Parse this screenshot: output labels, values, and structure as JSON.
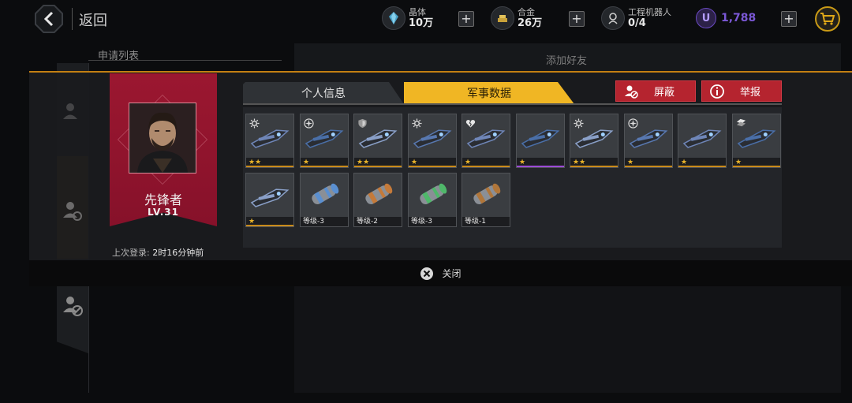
{
  "topbar": {
    "back_label": "返回",
    "crystal": {
      "name": "晶体",
      "value": "10万"
    },
    "alloy": {
      "name": "合金",
      "value": "26万"
    },
    "robots": {
      "name": "工程机器人",
      "value": "0/4"
    },
    "u_currency": {
      "symbol": "U",
      "value": "1,788"
    },
    "plus": "+"
  },
  "background": {
    "apply_list_label": "申请列表",
    "add_friend_label": "添加好友"
  },
  "profile": {
    "name": "先锋者",
    "level": "LV.31",
    "last_login_label": "上次登录:",
    "last_login_value": "2时16分钟前"
  },
  "tabs": {
    "personal": "个人信息",
    "military": "军事数据"
  },
  "actions": {
    "block": "屏蔽",
    "report": "举报"
  },
  "items": [
    {
      "badge": "gear-icon",
      "stars": "★★",
      "rarity": "orange"
    },
    {
      "badge": "burst-icon",
      "stars": "★",
      "rarity": "orange"
    },
    {
      "badge": "shield-icon",
      "stars": "★★",
      "rarity": "orange"
    },
    {
      "badge": "gear-icon",
      "stars": "★",
      "rarity": "orange"
    },
    {
      "badge": "broken-heart-icon",
      "stars": "★",
      "rarity": "orange"
    },
    {
      "badge": "",
      "stars": "★",
      "rarity": "purple"
    },
    {
      "badge": "gear-icon",
      "stars": "★★",
      "rarity": "orange"
    },
    {
      "badge": "burst-icon",
      "stars": "★",
      "rarity": "orange"
    },
    {
      "badge": "",
      "stars": "★",
      "rarity": "orange"
    },
    {
      "badge": "stack-icon",
      "stars": "★",
      "rarity": "orange"
    },
    {
      "badge": "",
      "stars": "★",
      "rarity": "orange"
    },
    {
      "badge": "",
      "level": "等级-3",
      "rarity": "none"
    },
    {
      "badge": "",
      "level": "等级-2",
      "rarity": "none"
    },
    {
      "badge": "",
      "level": "等级-3",
      "rarity": "none"
    },
    {
      "badge": "",
      "level": "等级-1",
      "rarity": "none"
    }
  ],
  "close_label": "关闭",
  "colors": {
    "accent_gold": "#f0b624",
    "banner_red": "#9b1730",
    "button_red": "#b5242f",
    "u_purple": "#7b58d6"
  }
}
